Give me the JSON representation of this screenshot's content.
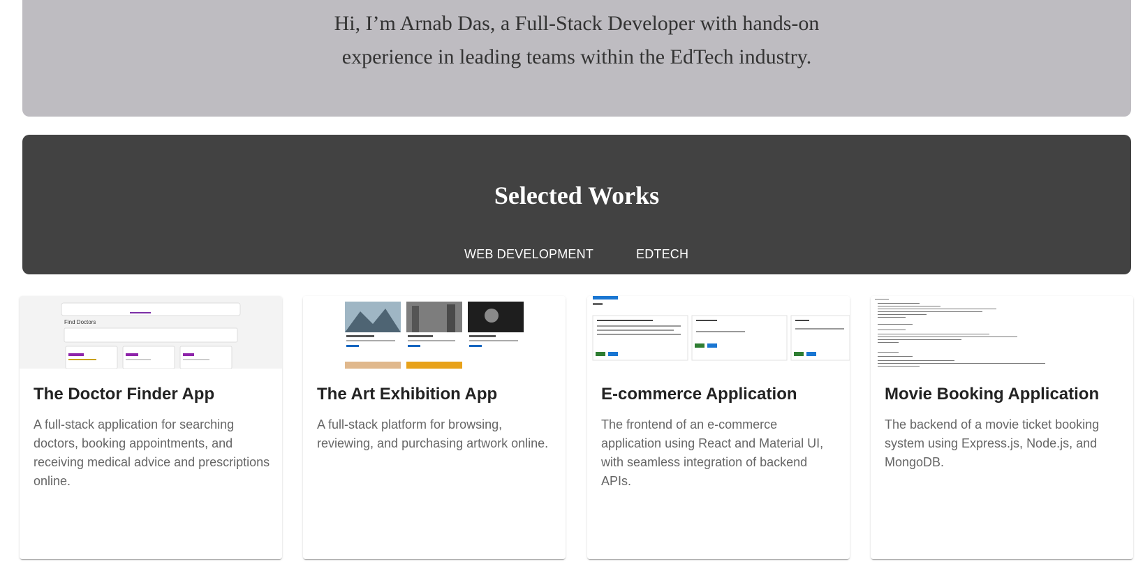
{
  "intro": {
    "line1": "Hi, I’m Arnab Das, a Full-Stack Developer with hands-on",
    "line2": "experience in leading teams within the EdTech industry."
  },
  "works": {
    "title": "Selected Works",
    "tabs": [
      {
        "label": "WEB DEVELOPMENT"
      },
      {
        "label": "EDTECH"
      }
    ]
  },
  "cards": [
    {
      "title": "The Doctor Finder App",
      "description": "A full-stack application for searching doctors, booking appointments, and receiving medical advice and prescriptions online.",
      "thumbnail": {
        "heading": "Find Doctors"
      }
    },
    {
      "title": "The Art Exhibition App",
      "description": "A full-stack platform for browsing, reviewing, and purchasing artwork online."
    },
    {
      "title": "E-commerce Application",
      "description": "The frontend of an e-commerce application using React and Material UI, with seamless integration of backend APIs."
    },
    {
      "title": "Movie Booking Application",
      "description": "The backend of a movie ticket booking system using Express.js, Node.js, and MongoDB."
    }
  ],
  "colors": {
    "intro_bg": "#bebcc1",
    "works_bg": "#424242"
  }
}
